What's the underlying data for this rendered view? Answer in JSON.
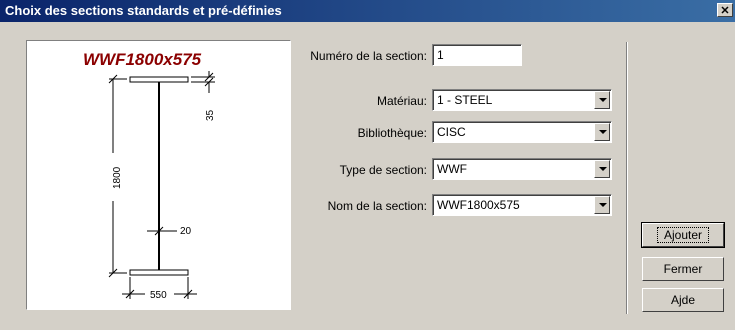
{
  "window": {
    "title": "Choix des sections standards et pré-définies"
  },
  "preview": {
    "section_title": "WWF1800x575",
    "dims": {
      "flange_thickness": "35",
      "height": "1800",
      "web_thickness": "20",
      "width": "550"
    }
  },
  "form": {
    "numero": {
      "label": "Numéro de la section:",
      "value": "1"
    },
    "materiau": {
      "label": "Matériau:",
      "value": "1 - STEEL"
    },
    "bibliotheque": {
      "label": "Bibliothèque:",
      "value": "CISC"
    },
    "type": {
      "label": "Type de section:",
      "value": "WWF"
    },
    "nom": {
      "label": "Nom de la section:",
      "value": "WWF1800x575"
    }
  },
  "buttons": {
    "ajouter": "Ajouter",
    "fermer": "Fermer",
    "aide": "Ajde"
  },
  "colors": {
    "title_bar": "#0a246a",
    "section_title": "#8b0000"
  }
}
